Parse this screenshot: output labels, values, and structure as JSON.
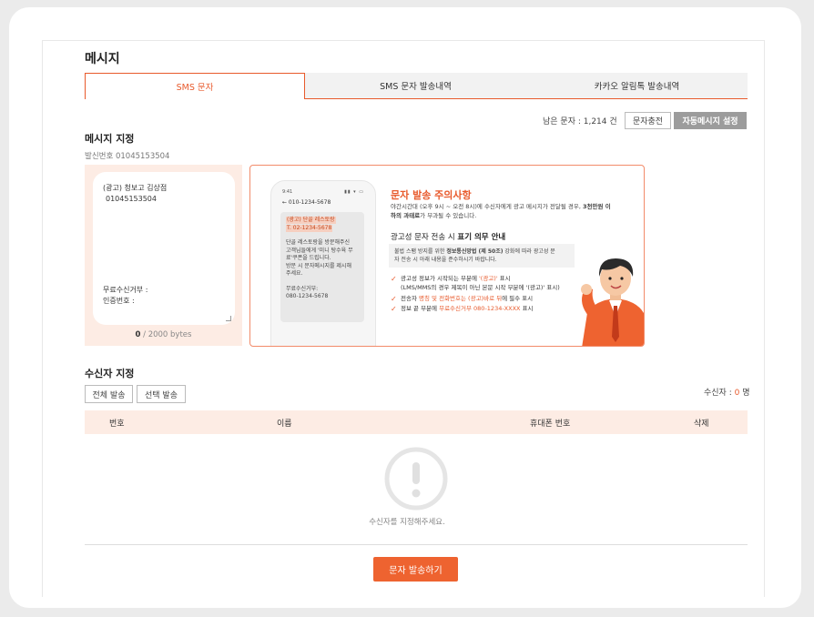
{
  "page": {
    "title": "메시지"
  },
  "tabs": [
    {
      "label": "SMS 문자",
      "active": true
    },
    {
      "label": "SMS 문자 발송내역",
      "active": false
    },
    {
      "label": "카카오 알림톡 발송내역",
      "active": false
    }
  ],
  "balance": {
    "label": "남은 문자 : 1,214 건",
    "charge_button": "문자충전",
    "auto_button": "자동메시지 설정"
  },
  "message": {
    "section_title": "메시지 지정",
    "sender_label": "발신번호 01045153504",
    "body_line1": "(광고) 청보고 김상점",
    "body_line2": "01045153504",
    "optout": "무료수신거부 :",
    "auth": "인증번호 :",
    "bytes_current": "0",
    "bytes_total": " / 2000 bytes"
  },
  "phone_preview": {
    "status_time": "9:41",
    "status_icons": "▮▮ ▾ ▭",
    "number": "← 010-1234-5678",
    "head1": "(광고) 단골 레스토랑",
    "head2": "T. 02-1234-5678",
    "body1": "단골 레스토랑을 방문해주신",
    "body2": "고객님들에게 '미니 탕수육 무",
    "body3": "료'쿠폰을 드립니다.",
    "body4": "방문 시 문자메시지를 제시해",
    "body5": "주세요.",
    "optout1": "무료수신거부:",
    "optout2": "080-1234-5678"
  },
  "notice": {
    "title": "문자 발송 주의사항",
    "desc_pre": "야간시간대 (오후 9시 ~ 오전 8시)에 수신자에게 광고 메시지가 전달될 경우, ",
    "desc_bold": "3천만원 이",
    "desc_line2_bold": "하의 과태료",
    "desc_line2_rest": "가 부과될 수 있습니다.",
    "sub_pre": "광고성 문자 전송 시 ",
    "sub_bold": "표기 의무 안내",
    "box_pre": "불법 스팸 방지를 위한 ",
    "box_bold": "정보통신망법 (제 50조)",
    "box_post": " 강화에 따라 광고성 문",
    "box_line2": "자 전송 시 아래 내용을 준수하시기 바랍니다.",
    "item1_pre": "광고성 정보가 시작되는 부분에 ",
    "item1_hl": "'(광고)'",
    "item1_post": " 표시",
    "item1_line2": "(LMS/MMS의 경우 제목이 아닌 본문 시작 부분에 '(광고)' 표시)",
    "item2_pre": "전송자 ",
    "item2_hl": "명칭 및 전화번호는 (광고)바로 뒤",
    "item2_post": "에 필수 표시",
    "item3_pre": "정보 끝 부분에 ",
    "item3_hl": "무료수신거부 080-1234-XXXX",
    "item3_post": " 표시"
  },
  "recipients": {
    "section_title": "수신자 지정",
    "all_button": "전체 발송",
    "select_button": "선택 발송",
    "count_label": "수신자 : ",
    "count_value": "0",
    "count_unit": " 명",
    "columns": [
      "번호",
      "이름",
      "휴대폰 번호",
      "삭제"
    ],
    "empty_text": "수신자를 지정해주세요."
  },
  "send_button": "문자 발송하기",
  "colors": {
    "accent": "#e85a2c",
    "accent_light": "#fdece4",
    "send": "#ee6330",
    "gray_button": "#9c9c9c"
  }
}
